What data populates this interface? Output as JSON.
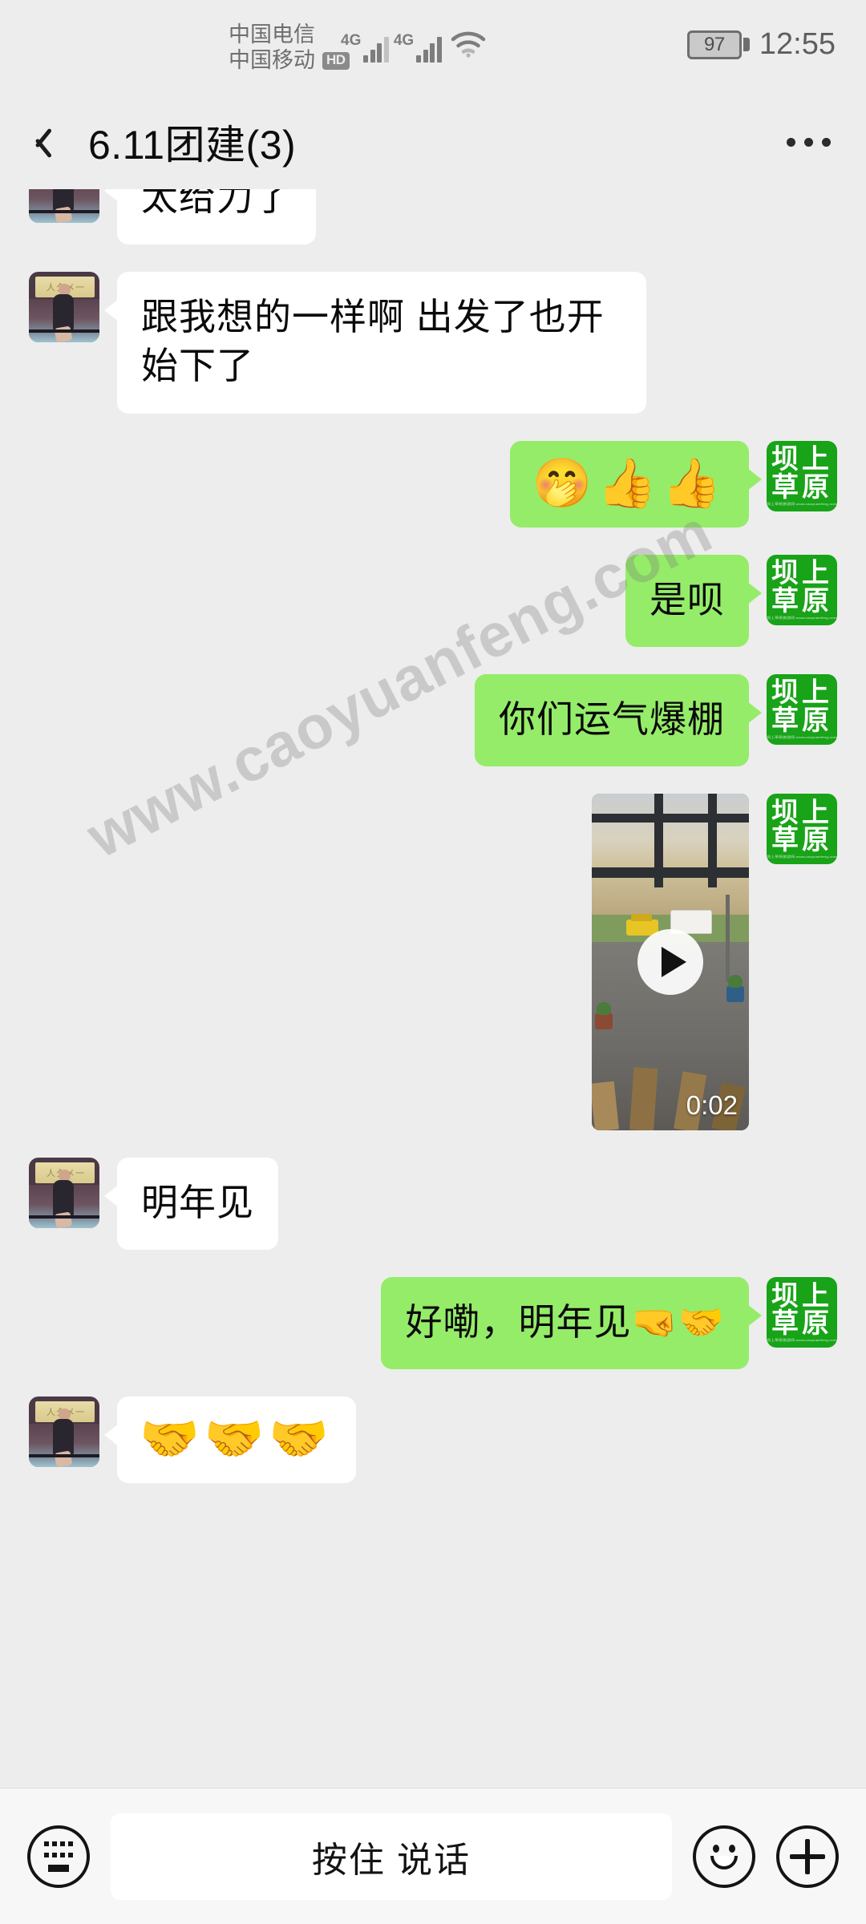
{
  "status_bar": {
    "carrier_1": "中国电信",
    "carrier_2": "中国移动",
    "hd_badge": "HD",
    "network_1": "4G",
    "network_2": "4G",
    "wifi_icon": "wifi-icon",
    "battery_percent": "97",
    "time": "12:55"
  },
  "header": {
    "back_icon": "chevron-left-icon",
    "title": "6.11团建(3)",
    "more_icon": "more-options-icon"
  },
  "avatars": {
    "outgoing_name_line1": "坝上",
    "outgoing_name_line2": "草原",
    "outgoing_tiny": "坝上草原旅游网 www.caoyuanfeng.com"
  },
  "colors": {
    "background": "#ededed",
    "incoming_bubble": "#ffffff",
    "outgoing_bubble": "#95ec69",
    "avatar_green": "#18a318",
    "text": "#0a0a0a"
  },
  "messages": [
    {
      "id": "msg-1",
      "direction": "in",
      "type": "text",
      "text": "太给力了"
    },
    {
      "id": "msg-2",
      "direction": "in",
      "type": "text",
      "text": "跟我想的一样啊 出发了也开始下了"
    },
    {
      "id": "msg-3",
      "direction": "out",
      "type": "emoji",
      "text": "🤭👍👍"
    },
    {
      "id": "msg-4",
      "direction": "out",
      "type": "text",
      "text": "是呗"
    },
    {
      "id": "msg-5",
      "direction": "out",
      "type": "text",
      "text": "你们运气爆棚"
    },
    {
      "id": "msg-6",
      "direction": "out",
      "type": "video",
      "duration": "0:02",
      "play_icon": "play-icon"
    },
    {
      "id": "msg-7",
      "direction": "in",
      "type": "text",
      "text": "明年见"
    },
    {
      "id": "msg-8",
      "direction": "out",
      "type": "text",
      "text": "好嘞，明年见🤜🤝"
    },
    {
      "id": "msg-9",
      "direction": "in",
      "type": "emoji",
      "text": "🤝🤝🤝"
    }
  ],
  "watermark": {
    "text": "www.caoyuanfeng.com"
  },
  "input_bar": {
    "keyboard_icon": "keyboard-icon",
    "voice_label": "按住 说话",
    "emoji_icon": "smiley-icon",
    "plus_icon": "plus-icon"
  }
}
